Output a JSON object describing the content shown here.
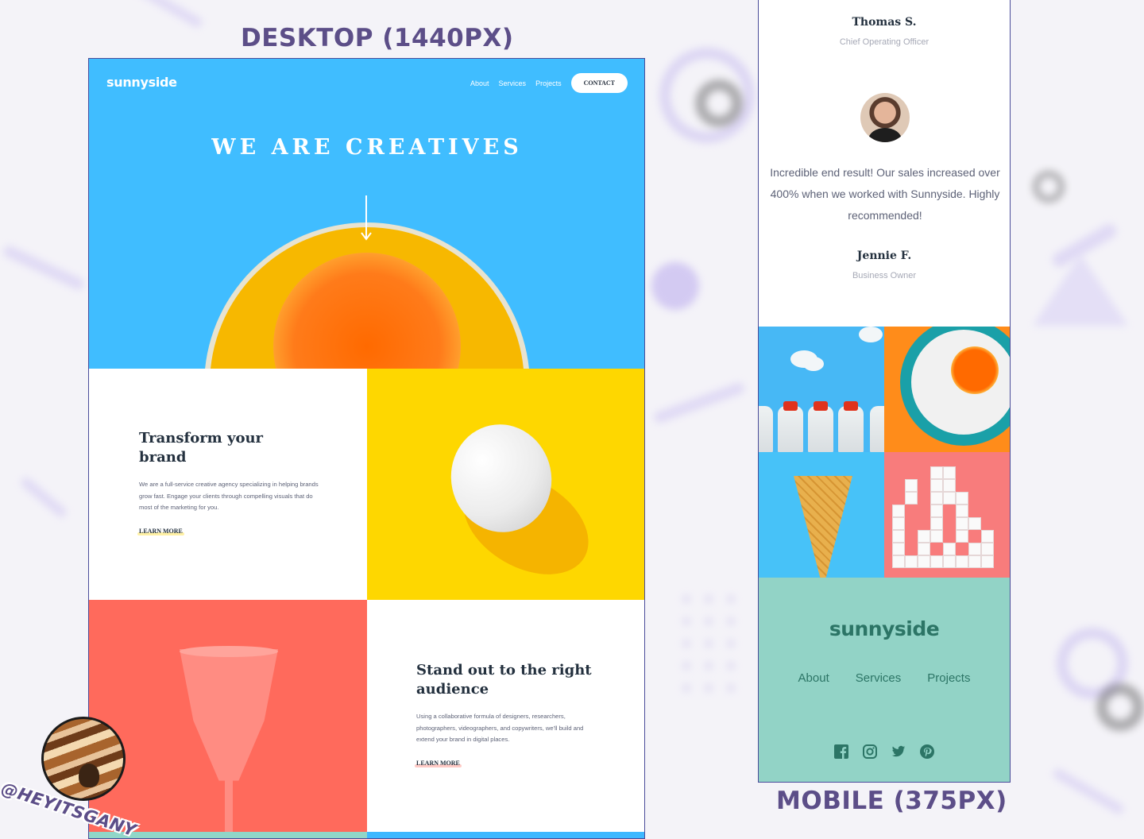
{
  "labels": {
    "desktop": "DESKTOP (1440PX)",
    "mobile": "MOBILE (375PX)",
    "handle": "@HEYITSGANY"
  },
  "desktop": {
    "logo": "sunnyside",
    "nav": {
      "about": "About",
      "services": "Services",
      "projects": "Projects",
      "contact": "CONTACT"
    },
    "hero_title": "WE ARE CREATIVES",
    "section1": {
      "title_line1": "Transform your",
      "title_line2": "brand",
      "body": "We are a full-service creative agency specializing in helping brands grow fast. Engage your clients through compelling visuals that do most of the marketing for you.",
      "link": "LEARN MORE"
    },
    "section2": {
      "title_line1": "Stand out to the right",
      "title_line2": "audience",
      "body": "Using a collaborative formula of designers, researchers, photographers, videographers, and copywriters, we'll build and extend your brand in digital places.",
      "link": "LEARN MORE"
    }
  },
  "mobile": {
    "testimonial_prev": {
      "name": "Thomas S.",
      "role": "Chief Operating Officer"
    },
    "testimonial": {
      "quote": "Incredible end result! Our sales increased over 400% when we worked with Sunnyside. Highly recommended!",
      "name": "Jennie F.",
      "role": "Business Owner"
    },
    "footer": {
      "logo": "sunnyside",
      "nav": {
        "about": "About",
        "services": "Services",
        "projects": "Projects"
      },
      "social_icons": [
        "facebook-icon",
        "instagram-icon",
        "twitter-icon",
        "pinterest-icon"
      ]
    }
  },
  "colors": {
    "hero_blue": "#40bdff",
    "yellow": "#fed700",
    "coral": "#ff6a5c",
    "mint": "#92d3c6",
    "dark_text": "#23303e",
    "footer_text": "#2c7566",
    "label_purple": "#5c4e88"
  }
}
